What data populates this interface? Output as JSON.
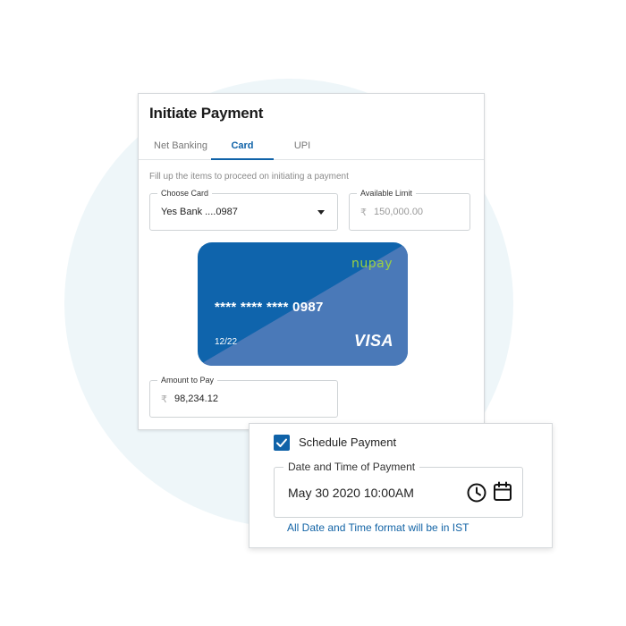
{
  "payment": {
    "title": "Initiate Payment",
    "tabs": [
      {
        "label": "Net Banking"
      },
      {
        "label": "Card"
      },
      {
        "label": "UPI"
      }
    ],
    "active_tab": "Card",
    "hint": "Fill up the items to proceed on initiating a payment",
    "choose_card": {
      "label": "Choose Card",
      "value": "Yes Bank ....0987"
    },
    "available_limit": {
      "label": "Available Limit",
      "currency": "₹",
      "value": "150,000.00"
    },
    "card": {
      "brand": "nupay",
      "number": "**** **** **** 0987",
      "expiry": "12/22",
      "network": "VISA"
    },
    "amount": {
      "label": "Amount to Pay",
      "currency": "₹",
      "value": "98,234.12"
    }
  },
  "schedule": {
    "checkbox_label": "Schedule Payment",
    "checked": true,
    "datetime": {
      "label": "Date and Time of Payment",
      "value": "May 30 2020 10:00AM"
    },
    "note": "All Date and Time format will be in IST"
  },
  "colors": {
    "accent": "#0f62a8",
    "card": "#0f64ac",
    "card_shade": "#4a79b8",
    "brand": "#9bd240",
    "background_circle": "#eef6f9"
  },
  "icons": [
    "dropdown-caret-icon",
    "check-icon",
    "clock-icon",
    "calendar-icon"
  ]
}
